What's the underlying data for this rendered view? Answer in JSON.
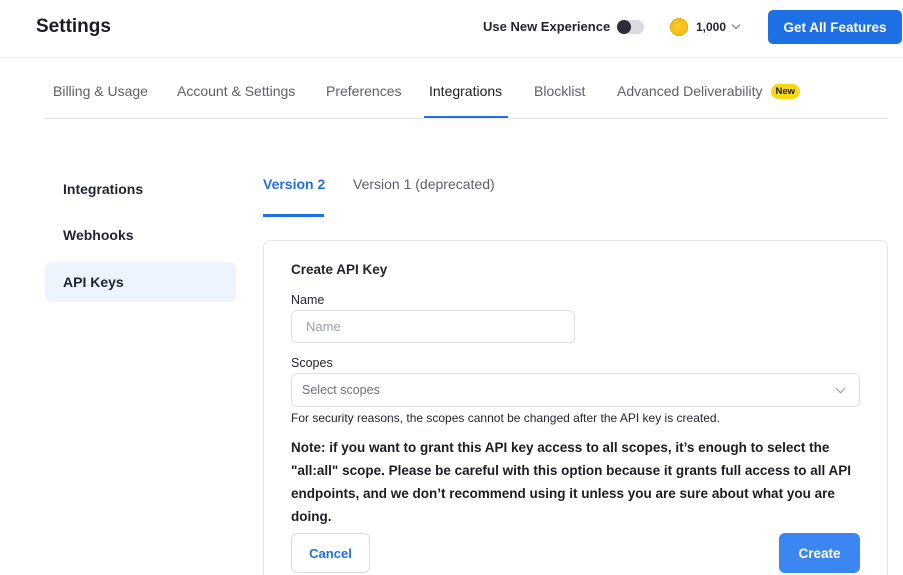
{
  "header": {
    "title": "Settings",
    "new_experience_label": "Use New Experience",
    "credits": "1,000",
    "credit_icon_glyph": "⚡",
    "cta_label": "Get All Features"
  },
  "tabs": [
    {
      "label": "Billing & Usage"
    },
    {
      "label": "Account & Settings"
    },
    {
      "label": "Preferences"
    },
    {
      "label": "Integrations"
    },
    {
      "label": "Blocklist"
    },
    {
      "label": "Advanced Deliverability",
      "badge": "New"
    }
  ],
  "sidebar": {
    "items": [
      {
        "label": "Integrations"
      },
      {
        "label": "Webhooks"
      },
      {
        "label": "API Keys"
      }
    ]
  },
  "subtabs": [
    {
      "label": "Version 2"
    },
    {
      "label": "Version 1 (deprecated)"
    }
  ],
  "form": {
    "title": "Create API Key",
    "name_label": "Name",
    "name_placeholder": "Name",
    "scopes_label": "Scopes",
    "scopes_placeholder": "Select scopes",
    "helper": "For security reasons, the scopes cannot be changed after the API key is created.",
    "note": "Note: if you want to grant this API key access to all scopes, it’s enough to select the \"all:all\" scope. Please be careful with this option because it grants full access to all API endpoints, and we don’t recommend using it unless you are sure about what you are doing.",
    "cancel_label": "Cancel",
    "create_label": "Create"
  },
  "colors": {
    "accent": "#1f6fe5",
    "badge_yellow": "#f7d613",
    "active_sidebar_bg": "#eef4fe"
  }
}
